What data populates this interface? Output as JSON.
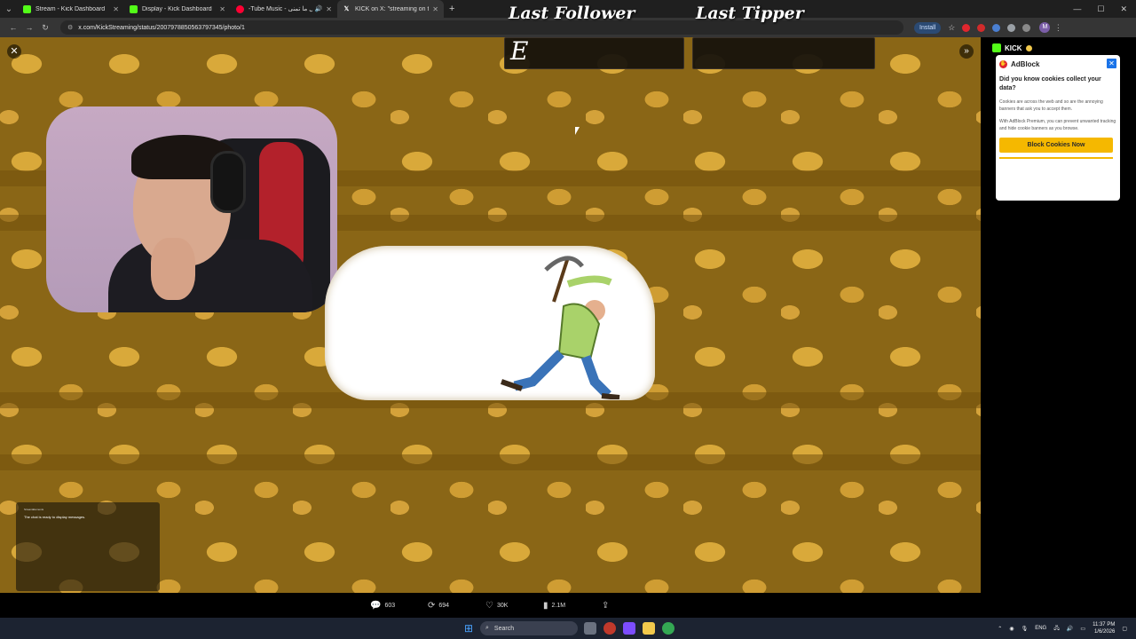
{
  "browser": {
    "tabs": [
      {
        "label": "Stream - Kick Dashboard",
        "favicon_color": "#53fc18"
      },
      {
        "label": "Display - Kick Dashboard",
        "favicon_color": "#53fc18"
      },
      {
        "label": "-Tube Music - كل ما تمنى",
        "favicon_color": "#ff0033"
      },
      {
        "label": "KICK on X: \"streaming on twit…",
        "favicon_color": "#ffffff"
      }
    ],
    "url": "x.com/KickStreaming/status/2007978850563797345/photo/1",
    "install_label": "Install",
    "window_controls": [
      "—",
      "☐",
      "✕"
    ]
  },
  "overlay": {
    "last_follower_label": "Last Follower",
    "last_follower_value": "E",
    "last_tipper_label": "Last Tipper",
    "last_tipper_value": ""
  },
  "photo": {
    "close_icon": "✕",
    "expand_icon": "»"
  },
  "chat_overlay": {
    "label": "StreamElements",
    "message": "The chat is ready to display messages."
  },
  "sidebar": {
    "channel": "KICK"
  },
  "adblock_popup": {
    "brand": "AdBlock",
    "question": "Did you know cookies collect your data?",
    "para1": "Cookies are across the web and so are the annoying banners that ask you to accept them.",
    "para2": "With AdBlock Premium, you can prevent unwanted tracking and hide cookie banners as you browse.",
    "button": "Block Cookies Now"
  },
  "engagement": {
    "replies": "603",
    "reposts": "694",
    "likes": "30K",
    "views": "2.1M"
  },
  "taskbar": {
    "search_placeholder": "Search",
    "language": "ENG",
    "time": "11:37 PM",
    "date": "1/6/2026"
  },
  "colors": {
    "accent_kick": "#53fc18",
    "adblock_button": "#f5b800",
    "dirt": "#8a6616"
  }
}
